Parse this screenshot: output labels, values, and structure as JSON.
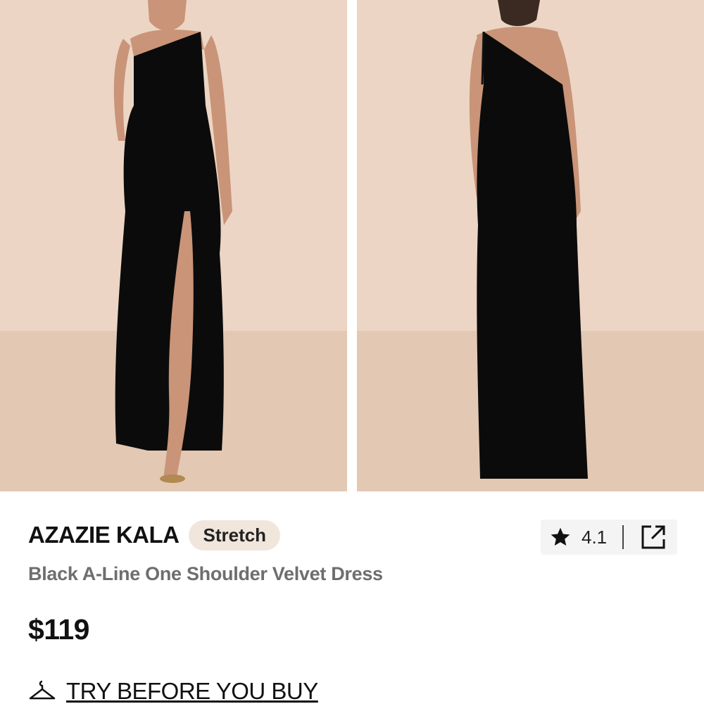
{
  "gallery": {
    "images": [
      {
        "alt": "front view",
        "icon": "dress-front-photo"
      },
      {
        "alt": "back view",
        "icon": "dress-back-photo"
      }
    ],
    "background_color": "#e8cfbd",
    "dress_color": "#0a0a0a"
  },
  "product": {
    "brand": "AZAZIE KALA",
    "badge": "Stretch",
    "name": "Black A-Line One Shoulder Velvet Dress",
    "price": "$119",
    "rating": "4.1",
    "rating_icon": "star-icon",
    "share_icon": "share-icon"
  },
  "try_before": {
    "label": "TRY BEFORE YOU BUY",
    "icon": "hanger-icon"
  }
}
